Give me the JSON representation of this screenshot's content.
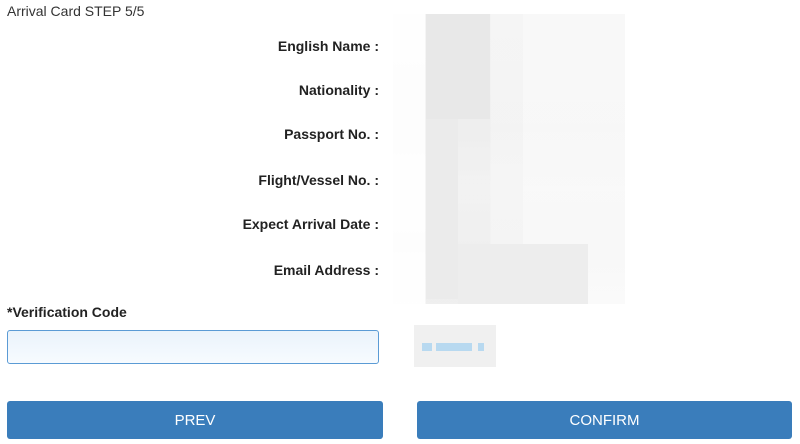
{
  "header": {
    "step_title": "Arrival Card STEP 5/5"
  },
  "fields": [
    {
      "label": "English Name :"
    },
    {
      "label": "Nationality :"
    },
    {
      "label": "Passport No. :"
    },
    {
      "label": "Flight/Vessel No. :"
    },
    {
      "label": "Expect Arrival Date :"
    },
    {
      "label": "Email Address :"
    }
  ],
  "verification": {
    "label": "*Verification Code",
    "value": "",
    "placeholder": ""
  },
  "buttons": {
    "prev": "PREV",
    "confirm": "CONFIRM"
  },
  "colors": {
    "button_bg": "#3a7dbb",
    "input_border": "#5b9bd5"
  }
}
